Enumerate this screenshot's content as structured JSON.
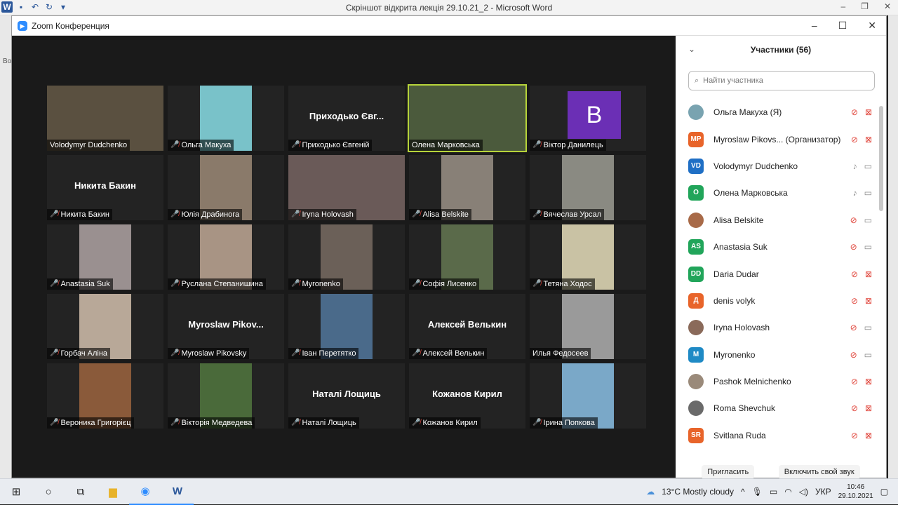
{
  "word": {
    "title": "Скріншот відкрита лекція 29.10.21_2 - Microsoft Word",
    "left_text": "Во"
  },
  "zoom": {
    "window_title": "Zoom Конференция"
  },
  "gallery": [
    {
      "name": "Volodymyr Dudchenko",
      "muted": false,
      "big": "",
      "cam": "#5a5040"
    },
    {
      "name": "Ольга Макуха",
      "muted": true,
      "big": "",
      "cam": "#79c2c9"
    },
    {
      "name": "Приходько Євгеній",
      "muted": true,
      "big": "Приходько Євг...",
      "cam": ""
    },
    {
      "name": "Олена Марковська",
      "muted": false,
      "big": "",
      "cam": "#4b5a3c",
      "active": true
    },
    {
      "name": "Віктор Данилець",
      "muted": true,
      "big": "",
      "cam": "",
      "avatar": "B"
    },
    {
      "name": "Никита Бакин",
      "muted": true,
      "big": "Никита Бакин",
      "cam": ""
    },
    {
      "name": "Юлія Драбинога",
      "muted": true,
      "big": "",
      "cam": "#8a7a6a"
    },
    {
      "name": "Iryna Holovash",
      "muted": true,
      "big": "",
      "cam": "#6a5a58"
    },
    {
      "name": "Alisa Belskite",
      "muted": true,
      "big": "",
      "cam": "#888077"
    },
    {
      "name": "Вячеслав Урсал",
      "muted": true,
      "big": "",
      "cam": "#8a8a82"
    },
    {
      "name": "Anastasia Suk",
      "muted": true,
      "big": "",
      "cam": "#9a9090"
    },
    {
      "name": "Руслана Степанишина",
      "muted": true,
      "big": "",
      "cam": "#a89484"
    },
    {
      "name": "Myronenko",
      "muted": true,
      "big": "",
      "cam": "#6b6058"
    },
    {
      "name": "Софія Лисенко",
      "muted": true,
      "big": "",
      "cam": "#5a6a4a"
    },
    {
      "name": "Тетяна Ходос",
      "muted": true,
      "big": "",
      "cam": "#c9c2a4"
    },
    {
      "name": "Горбач Аліна",
      "muted": true,
      "big": "",
      "cam": "#b8a898"
    },
    {
      "name": "Myroslaw Pikovsky",
      "muted": true,
      "big": "Myroslaw  Pikov...",
      "cam": ""
    },
    {
      "name": "Іван Перетятко",
      "muted": true,
      "big": "",
      "cam": "#4a6a8a"
    },
    {
      "name": "Алексей Велькин",
      "muted": true,
      "big": "Алексей Велькин",
      "cam": ""
    },
    {
      "name": "Илья Федосеев",
      "muted": false,
      "big": "",
      "cam": "#9a9a9a"
    },
    {
      "name": "Вероника Григорієц",
      "muted": true,
      "big": "",
      "cam": "#8a5a3a"
    },
    {
      "name": "Вікторія Медведева",
      "muted": true,
      "big": "",
      "cam": "#4a6a3a"
    },
    {
      "name": "Наталі Лощиць",
      "muted": true,
      "big": "Наталі Лощиць",
      "cam": ""
    },
    {
      "name": "Кожанов Кирил",
      "muted": true,
      "big": "Кожанов Кирил",
      "cam": ""
    },
    {
      "name": "Ірина Попкова",
      "muted": true,
      "big": "",
      "cam": "#7aa8c8"
    }
  ],
  "panel": {
    "title": "Участники (56)",
    "search_placeholder": "Найти участника",
    "invite_label": "Пригласить",
    "unmute_label": "Включить свой звук",
    "participants": [
      {
        "name": "Ольга Макуха (Я)",
        "initials": "",
        "color": "#79a3b0",
        "mic_muted": true,
        "video_off": true
      },
      {
        "name": "Myroslaw Pikovs... (Организатор)",
        "initials": "MP",
        "color": "#e8642a",
        "mic_muted": true,
        "video_off": true
      },
      {
        "name": "Volodymyr Dudchenko",
        "initials": "VD",
        "color": "#1f6fc5",
        "mic_muted": false,
        "video_off": false
      },
      {
        "name": "Олена Марковська",
        "initials": "О",
        "color": "#21a55a",
        "mic_muted": false,
        "video_off": false
      },
      {
        "name": "Alisa Belskite",
        "initials": "",
        "color": "#a86a48",
        "mic_muted": true,
        "video_off": false
      },
      {
        "name": "Anastasia Suk",
        "initials": "AS",
        "color": "#21a55a",
        "mic_muted": true,
        "video_off": false
      },
      {
        "name": "Daria Dudar",
        "initials": "DD",
        "color": "#21a55a",
        "mic_muted": true,
        "video_off": true
      },
      {
        "name": "denis volyk",
        "initials": "Д",
        "color": "#e8642a",
        "mic_muted": true,
        "video_off": true
      },
      {
        "name": "Iryna Holovash",
        "initials": "",
        "color": "#8a6a5a",
        "mic_muted": true,
        "video_off": false
      },
      {
        "name": "Myronenko",
        "initials": "M",
        "color": "#1f8ac5",
        "mic_muted": true,
        "video_off": false
      },
      {
        "name": "Pashok Melnichenko",
        "initials": "",
        "color": "#9a8a7a",
        "mic_muted": true,
        "video_off": true
      },
      {
        "name": "Roma Shevchuk",
        "initials": "",
        "color": "#6a6a6a",
        "mic_muted": true,
        "video_off": true
      },
      {
        "name": "Svitlana Ruda",
        "initials": "SR",
        "color": "#e8642a",
        "mic_muted": true,
        "video_off": true
      }
    ]
  },
  "taskbar": {
    "weather": "13°C  Mostly cloudy",
    "lang": "УКР",
    "time": "10:46",
    "date": "29.10.2021"
  }
}
